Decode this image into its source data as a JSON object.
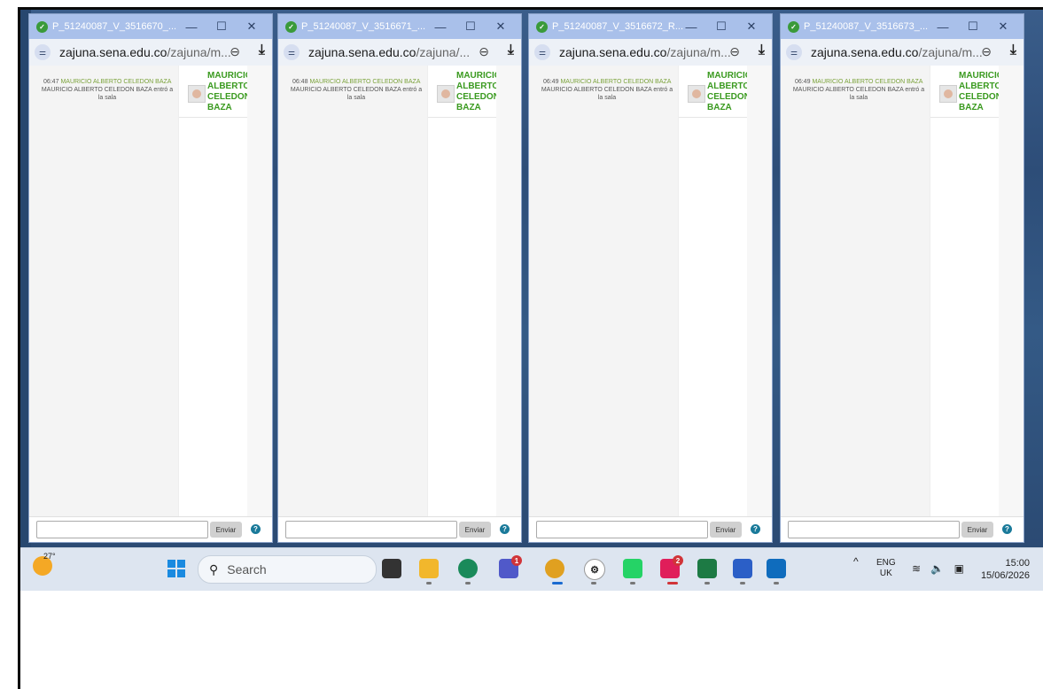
{
  "windows": [
    {
      "title": "P_51240087_V_3516670_...",
      "url_host": "zajuna.sena.edu.co",
      "url_path": "/zajuna/m...",
      "message": {
        "time": "06:47",
        "name": "MAURICIO ALBERTO CELEDON BAZA",
        "text": "MAURICIO ALBERTO CELEDON BAZA entró a la sala"
      },
      "participant": "MAURICIO ALBERTO CELEDON BAZA",
      "send_label": "Enviar"
    },
    {
      "title": "P_51240087_V_3516671_...",
      "url_host": "zajuna.sena.edu.co",
      "url_path": "/zajuna/...",
      "message": {
        "time": "06:48",
        "name": "MAURICIO ALBERTO CELEDON BAZA",
        "text": "MAURICIO ALBERTO CELEDON BAZA entró a la sala"
      },
      "participant": "MAURICIO ALBERTO CELEDON BAZA",
      "send_label": "Enviar"
    },
    {
      "title": "P_51240087_V_3516672_R...",
      "url_host": "zajuna.sena.edu.co",
      "url_path": "/zajuna/m...",
      "message": {
        "time": "06:49",
        "name": "MAURICIO ALBERTO CELEDON BAZA",
        "text": "MAURICIO ALBERTO CELEDON BAZA entró a la sala"
      },
      "participant": "MAURICIO ALBERTO CELEDON BAZA",
      "send_label": "Enviar"
    },
    {
      "title": "P_51240087_V_3516673_...",
      "url_host": "zajuna.sena.edu.co",
      "url_path": "/zajuna/m...",
      "message": {
        "time": "06:49",
        "name": "MAURICIO ALBERTO CELEDON BAZA",
        "text": "MAURICIO ALBERTO CELEDON BAZA entró a la sala"
      },
      "participant": "MAURICIO ALBERTO CELEDON BAZA",
      "send_label": "Enviar"
    }
  ],
  "window_controls": {
    "minimize": "—",
    "maximize": "☐",
    "close": "✕"
  },
  "taskbar": {
    "temperature": "27°",
    "search_placeholder": "Search",
    "teams_badge": "1",
    "slack_badge": "2",
    "language": "ENG",
    "region": "UK",
    "time": "15:00",
    "date": "15/06/2026"
  },
  "colors": {
    "accent": "#3a9a1f",
    "titlebar": "#a9c0ea",
    "help": "#1a7a9a"
  }
}
